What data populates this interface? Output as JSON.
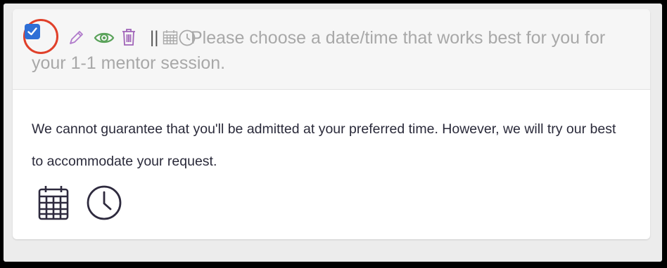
{
  "header": {
    "prompt": "Please choose a date/time that works best for you for your 1-1 mentor session.",
    "separator": "||",
    "checkbox_checked": true
  },
  "icons": {
    "edit": "pencil-icon",
    "view": "eye-icon",
    "delete": "trash-icon",
    "calendar": "calendar-icon",
    "clock": "clock-icon"
  },
  "body": {
    "note": "We cannot guarantee that you'll be admitted at your preferred time. However, we will try our best to accommodate your request."
  },
  "colors": {
    "checkbox": "#2f6fd6",
    "highlight_circle": "#e0402a",
    "pencil": "#b07acb",
    "eye": "#5aa25a",
    "trash": "#a064b8",
    "body_icons": "#2e2a3e"
  }
}
